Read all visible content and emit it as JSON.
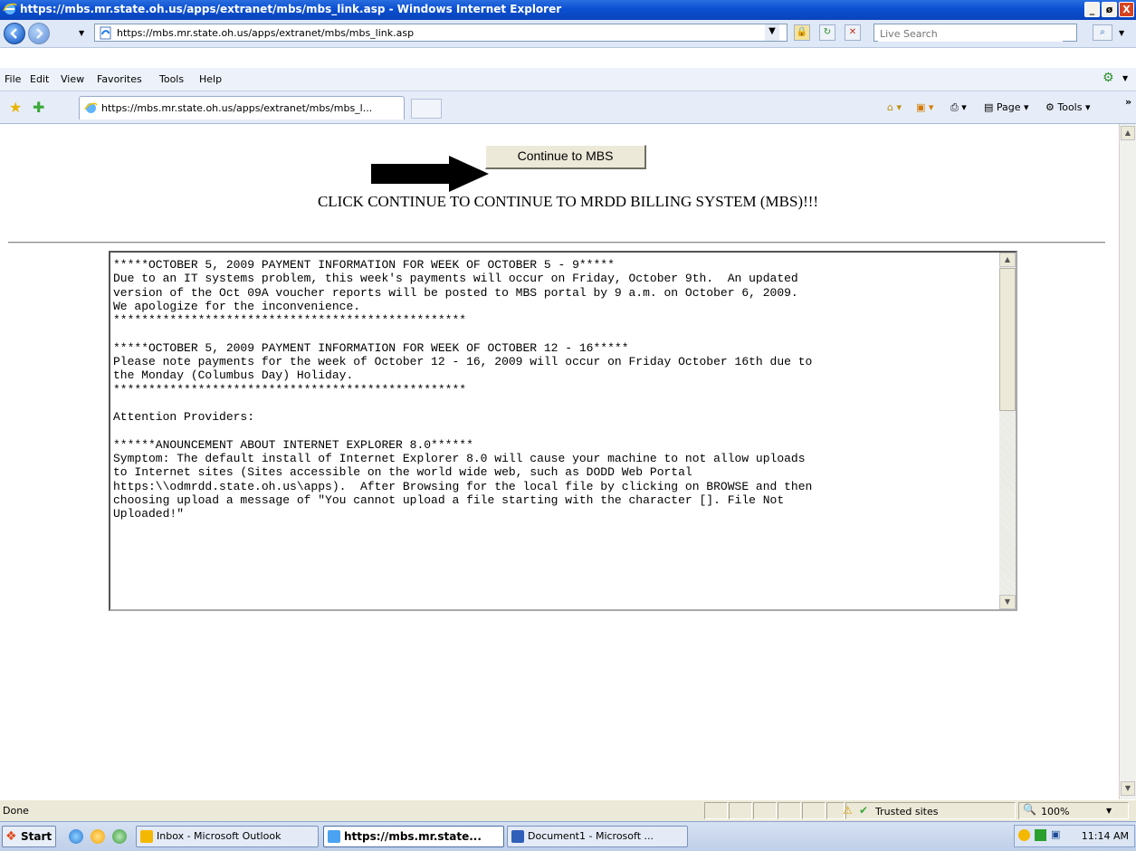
{
  "window": {
    "title": "https://mbs.mr.state.oh.us/apps/extranet/mbs/mbs_link.asp - Windows Internet Explorer",
    "min": "_",
    "max": "ø",
    "close": "X"
  },
  "address_bar": {
    "url": "https://mbs.mr.state.oh.us/apps/extranet/mbs/mbs_link.asp",
    "search_placeholder": "Live Search"
  },
  "menu": [
    "File",
    "Edit",
    "View",
    "Favorites",
    "Tools",
    "Help"
  ],
  "tab": {
    "label": "https://mbs.mr.state.oh.us/apps/extranet/mbs/mbs_l..."
  },
  "command_bar": {
    "page": "Page",
    "tools": "Tools"
  },
  "page": {
    "continue_button": "Continue to MBS",
    "message": "CLICK CONTINUE TO CONTINUE TO MRDD BILLING SYSTEM (MBS)!!!",
    "announcements": "*****OCTOBER 5, 2009 PAYMENT INFORMATION FOR WEEK OF OCTOBER 5 - 9*****\nDue to an IT systems problem, this week's payments will occur on Friday, October 9th.  An updated\nversion of the Oct 09A voucher reports will be posted to MBS portal by 9 a.m. on October 6, 2009.\nWe apologize for the inconvenience.\n**************************************************\n\n*****OCTOBER 5, 2009 PAYMENT INFORMATION FOR WEEK OF OCTOBER 12 - 16*****\nPlease note payments for the week of October 12 - 16, 2009 will occur on Friday October 16th due to\nthe Monday (Columbus Day) Holiday.\n**************************************************\n\nAttention Providers:\n\n******ANOUNCEMENT ABOUT INTERNET EXPLORER 8.0******\nSymptom: The default install of Internet Explorer 8.0 will cause your machine to not allow uploads\nto Internet sites (Sites accessible on the world wide web, such as DODD Web Portal\nhttps:\\\\odmrdd.state.oh.us\\apps).  After Browsing for the local file by clicking on BROWSE and then\nchoosing upload a message of \"You cannot upload a file starting with the character []. File Not\nUploaded!\""
  },
  "status_bar": {
    "status": "Done",
    "zone": "Trusted sites",
    "zoom": "100%"
  },
  "taskbar": {
    "start": "Start",
    "tasks": [
      "Inbox - Microsoft Outlook",
      "https://mbs.mr.state...",
      "Document1 - Microsoft ..."
    ],
    "clock": "11:14 AM"
  }
}
